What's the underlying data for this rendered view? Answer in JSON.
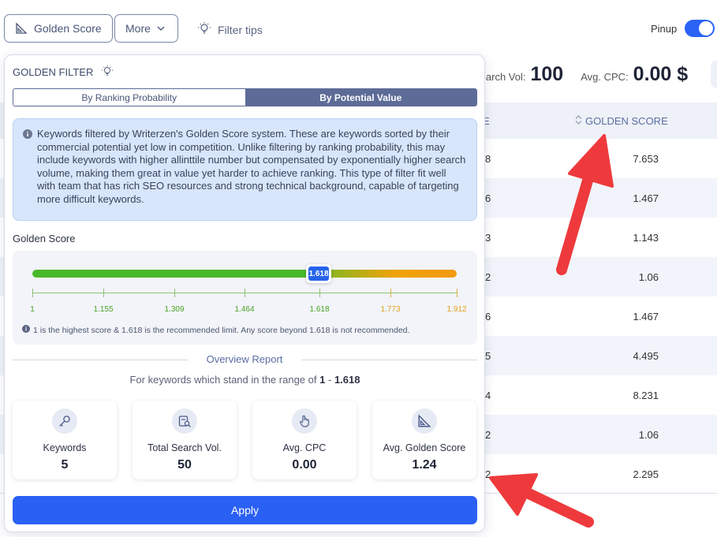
{
  "toolbar": {
    "golden_score_label": "Golden Score",
    "more_label": "More",
    "filter_tips_label": "Filter tips",
    "pinup_label": "Pinup",
    "pinup_on": true
  },
  "stats": {
    "search_vol_label": "Search Vol:",
    "search_vol_value": "100",
    "cpc_label": "Avg. CPC:",
    "cpc_value": "0.00 $"
  },
  "table": {
    "col_partial_header": "E",
    "golden_header": "GOLDEN SCORE",
    "rows": [
      {
        "c1": "8",
        "score": "7.653"
      },
      {
        "c1": "6",
        "score": "1.467"
      },
      {
        "c1": "3",
        "score": "1.143"
      },
      {
        "c1": "2",
        "score": "1.06"
      },
      {
        "c1": "6",
        "score": "1.467"
      },
      {
        "c1": "5",
        "score": "4.495"
      },
      {
        "c1": "4",
        "score": "8.231"
      },
      {
        "c1": "2",
        "score": "1.06"
      },
      {
        "c1": "2",
        "score": "2.295"
      }
    ]
  },
  "panel": {
    "title": "GOLDEN FILTER",
    "tab_ranking": "By Ranking Probability",
    "tab_value": "By Potential Value",
    "active_tab": "By Potential Value",
    "info_text": "Keywords filtered by Writerzen's Golden Score system. These are keywords sorted by their commercial potential yet low in competition. Unlike filtering by ranking probability, this may include keywords with higher allinttile number but compensated by exponentially higher search volume, making them great in value yet harder to achieve ranking. This type of filter fit well with team that has rich SEO resources and strong technical background, capable of targeting more difficult keywords.",
    "golden_score_label": "Golden Score",
    "slider_value": "1.618",
    "ticks": [
      "1",
      "1.155",
      "1.309",
      "1.464",
      "1.618",
      "1.773",
      "1.912"
    ],
    "note": "1 is the highest score & 1.618 is the recommended limit. Any score beyond 1.618 is not recommended.",
    "overview_title": "Overview Report",
    "range_prefix": "For keywords which stand in the range of",
    "range_low": "1",
    "range_sep": "-",
    "range_high": "1.618",
    "cards": [
      {
        "label": "Keywords",
        "value": "5",
        "icon": "key-icon"
      },
      {
        "label": "Total Search Vol.",
        "value": "50",
        "icon": "search-doc-icon"
      },
      {
        "label": "Avg. CPC",
        "value": "0.00",
        "icon": "pointer-icon"
      },
      {
        "label": "Avg. Golden Score",
        "value": "1.24",
        "icon": "golden-ratio-icon"
      }
    ],
    "apply_label": "Apply"
  },
  "colors": {
    "primary": "#2a60f4",
    "segment_active": "#5d6b97",
    "info_bg": "#d7e6fb",
    "slider_green": "#4ab82b",
    "slider_orange": "#f39a12",
    "arrow_red": "#ee3a3d"
  }
}
